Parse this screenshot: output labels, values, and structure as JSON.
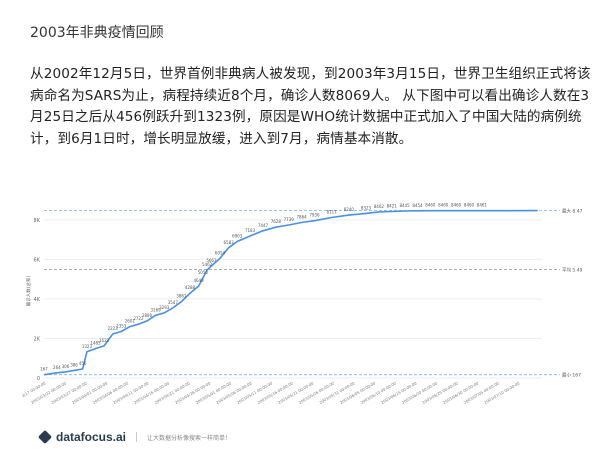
{
  "header": {
    "title": "2003年非典疫情回顾"
  },
  "intro": {
    "text": "从2002年12月5日，世界首例非典病人被发现，到2003年3月15日，世界卫生组织正式将该病命名为SARS为止，病程持续近8个月，确诊人数8069人。 从下图中可以看出确诊人数在3月25日之后从456例跃升到1323例，原因是WHO统计数据中正式加入了中国大陆的病例统计，到6月1日时，增长明显放缓，进入到7月，病情基本消散。"
  },
  "colors": {
    "line": "#4a90e2",
    "max_line": "#7ab0e8",
    "avg_line": "#9aa4ad",
    "min_line": "#7ab0e8",
    "grid": "#eeeeee",
    "label": "#666666"
  },
  "chart_data": {
    "type": "line",
    "ylabel": "确诊人数(总和)",
    "y_ticks": [
      "0",
      "2K",
      "4K",
      "6K",
      "8K"
    ],
    "y_tick_values": [
      0,
      2000,
      4000,
      6000,
      8000
    ],
    "ylim": [
      0,
      8800
    ],
    "reference_lines": [
      {
        "label": "最大 8.47K",
        "value": 8470
      },
      {
        "label": "平均 5.49K",
        "value": 5490
      },
      {
        "label": "最小 167",
        "value": 167
      }
    ],
    "x_tick_labels": [
      "2003/03/17 00:00:00",
      "2003/03/22 00:00:00",
      "2003/03/27 00:00:00",
      "2003/04/01 00:00:00",
      "2003/04/06 00:00:00",
      "2003/04/11 00:00:00",
      "2003/04/16 00:00:00",
      "2003/04/21 00:00:00",
      "2003/04/26 00:00:00",
      "2003/05/01 00:00:00",
      "2003/05/06 00:00:00",
      "2003/05/11 00:00:00",
      "2003/05/16 00:00:00",
      "2003/05/21 00:00:00",
      "2003/05/26 00:00:00",
      "2003/05/31 00:00:00",
      "2003/06/05 00:00:00",
      "2003/06/10 00:00:00",
      "2003/06/15 00:00:00",
      "2003/06/20 00:00:00",
      "2003/06/25 00:00:00",
      "2003/06/30 00:00:00",
      "2003/07/05 00:00:00",
      "2003/07/10 00:00:00"
    ],
    "series": [
      {
        "values": [
          167,
          264,
          306,
          386,
          456,
          1323,
          1485,
          1622,
          2223,
          2353,
          2601,
          2722,
          2890,
          3169,
          3293,
          3547,
          3861,
          4288,
          4649,
          5050,
          5462,
          5663,
          6054,
          6583,
          6903,
          7183,
          7447,
          7628,
          7739,
          7864,
          7956,
          8117,
          8240,
          8323,
          8402,
          8421,
          8445,
          8454,
          8460,
          8460,
          8460,
          8460,
          8461,
          8465
        ],
        "x_positions": [
          0,
          3,
          5,
          7,
          9,
          10,
          12,
          14,
          16,
          18,
          20,
          22,
          24,
          26,
          28,
          30,
          32,
          34,
          36,
          37,
          38,
          39,
          41,
          43,
          45,
          48,
          51,
          54,
          57,
          60,
          63,
          67,
          71,
          75,
          78,
          81,
          84,
          87,
          90,
          93,
          96,
          99,
          102,
          115
        ]
      }
    ],
    "x_range": [
      0,
      116
    ]
  },
  "footer": {
    "brand": "datafocus.ai",
    "slogan": "让大数据分析像搜索一样简单！"
  }
}
